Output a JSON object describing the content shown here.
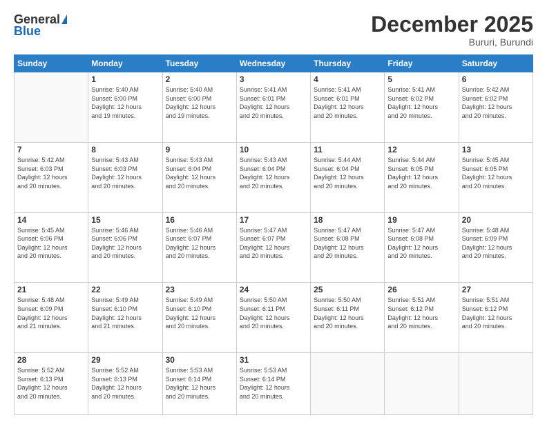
{
  "header": {
    "logo_general": "General",
    "logo_blue": "Blue",
    "month": "December 2025",
    "location": "Bururi, Burundi"
  },
  "days_of_week": [
    "Sunday",
    "Monday",
    "Tuesday",
    "Wednesday",
    "Thursday",
    "Friday",
    "Saturday"
  ],
  "weeks": [
    [
      {
        "day": "",
        "info": ""
      },
      {
        "day": "1",
        "info": "Sunrise: 5:40 AM\nSunset: 6:00 PM\nDaylight: 12 hours\nand 19 minutes."
      },
      {
        "day": "2",
        "info": "Sunrise: 5:40 AM\nSunset: 6:00 PM\nDaylight: 12 hours\nand 19 minutes."
      },
      {
        "day": "3",
        "info": "Sunrise: 5:41 AM\nSunset: 6:01 PM\nDaylight: 12 hours\nand 20 minutes."
      },
      {
        "day": "4",
        "info": "Sunrise: 5:41 AM\nSunset: 6:01 PM\nDaylight: 12 hours\nand 20 minutes."
      },
      {
        "day": "5",
        "info": "Sunrise: 5:41 AM\nSunset: 6:02 PM\nDaylight: 12 hours\nand 20 minutes."
      },
      {
        "day": "6",
        "info": "Sunrise: 5:42 AM\nSunset: 6:02 PM\nDaylight: 12 hours\nand 20 minutes."
      }
    ],
    [
      {
        "day": "7",
        "info": "Sunrise: 5:42 AM\nSunset: 6:03 PM\nDaylight: 12 hours\nand 20 minutes."
      },
      {
        "day": "8",
        "info": "Sunrise: 5:43 AM\nSunset: 6:03 PM\nDaylight: 12 hours\nand 20 minutes."
      },
      {
        "day": "9",
        "info": "Sunrise: 5:43 AM\nSunset: 6:04 PM\nDaylight: 12 hours\nand 20 minutes."
      },
      {
        "day": "10",
        "info": "Sunrise: 5:43 AM\nSunset: 6:04 PM\nDaylight: 12 hours\nand 20 minutes."
      },
      {
        "day": "11",
        "info": "Sunrise: 5:44 AM\nSunset: 6:04 PM\nDaylight: 12 hours\nand 20 minutes."
      },
      {
        "day": "12",
        "info": "Sunrise: 5:44 AM\nSunset: 6:05 PM\nDaylight: 12 hours\nand 20 minutes."
      },
      {
        "day": "13",
        "info": "Sunrise: 5:45 AM\nSunset: 6:05 PM\nDaylight: 12 hours\nand 20 minutes."
      }
    ],
    [
      {
        "day": "14",
        "info": "Sunrise: 5:45 AM\nSunset: 6:06 PM\nDaylight: 12 hours\nand 20 minutes."
      },
      {
        "day": "15",
        "info": "Sunrise: 5:46 AM\nSunset: 6:06 PM\nDaylight: 12 hours\nand 20 minutes."
      },
      {
        "day": "16",
        "info": "Sunrise: 5:46 AM\nSunset: 6:07 PM\nDaylight: 12 hours\nand 20 minutes."
      },
      {
        "day": "17",
        "info": "Sunrise: 5:47 AM\nSunset: 6:07 PM\nDaylight: 12 hours\nand 20 minutes."
      },
      {
        "day": "18",
        "info": "Sunrise: 5:47 AM\nSunset: 6:08 PM\nDaylight: 12 hours\nand 20 minutes."
      },
      {
        "day": "19",
        "info": "Sunrise: 5:47 AM\nSunset: 6:08 PM\nDaylight: 12 hours\nand 20 minutes."
      },
      {
        "day": "20",
        "info": "Sunrise: 5:48 AM\nSunset: 6:09 PM\nDaylight: 12 hours\nand 20 minutes."
      }
    ],
    [
      {
        "day": "21",
        "info": "Sunrise: 5:48 AM\nSunset: 6:09 PM\nDaylight: 12 hours\nand 21 minutes."
      },
      {
        "day": "22",
        "info": "Sunrise: 5:49 AM\nSunset: 6:10 PM\nDaylight: 12 hours\nand 21 minutes."
      },
      {
        "day": "23",
        "info": "Sunrise: 5:49 AM\nSunset: 6:10 PM\nDaylight: 12 hours\nand 20 minutes."
      },
      {
        "day": "24",
        "info": "Sunrise: 5:50 AM\nSunset: 6:11 PM\nDaylight: 12 hours\nand 20 minutes."
      },
      {
        "day": "25",
        "info": "Sunrise: 5:50 AM\nSunset: 6:11 PM\nDaylight: 12 hours\nand 20 minutes."
      },
      {
        "day": "26",
        "info": "Sunrise: 5:51 AM\nSunset: 6:12 PM\nDaylight: 12 hours\nand 20 minutes."
      },
      {
        "day": "27",
        "info": "Sunrise: 5:51 AM\nSunset: 6:12 PM\nDaylight: 12 hours\nand 20 minutes."
      }
    ],
    [
      {
        "day": "28",
        "info": "Sunrise: 5:52 AM\nSunset: 6:13 PM\nDaylight: 12 hours\nand 20 minutes."
      },
      {
        "day": "29",
        "info": "Sunrise: 5:52 AM\nSunset: 6:13 PM\nDaylight: 12 hours\nand 20 minutes."
      },
      {
        "day": "30",
        "info": "Sunrise: 5:53 AM\nSunset: 6:14 PM\nDaylight: 12 hours\nand 20 minutes."
      },
      {
        "day": "31",
        "info": "Sunrise: 5:53 AM\nSunset: 6:14 PM\nDaylight: 12 hours\nand 20 minutes."
      },
      {
        "day": "",
        "info": ""
      },
      {
        "day": "",
        "info": ""
      },
      {
        "day": "",
        "info": ""
      }
    ]
  ]
}
